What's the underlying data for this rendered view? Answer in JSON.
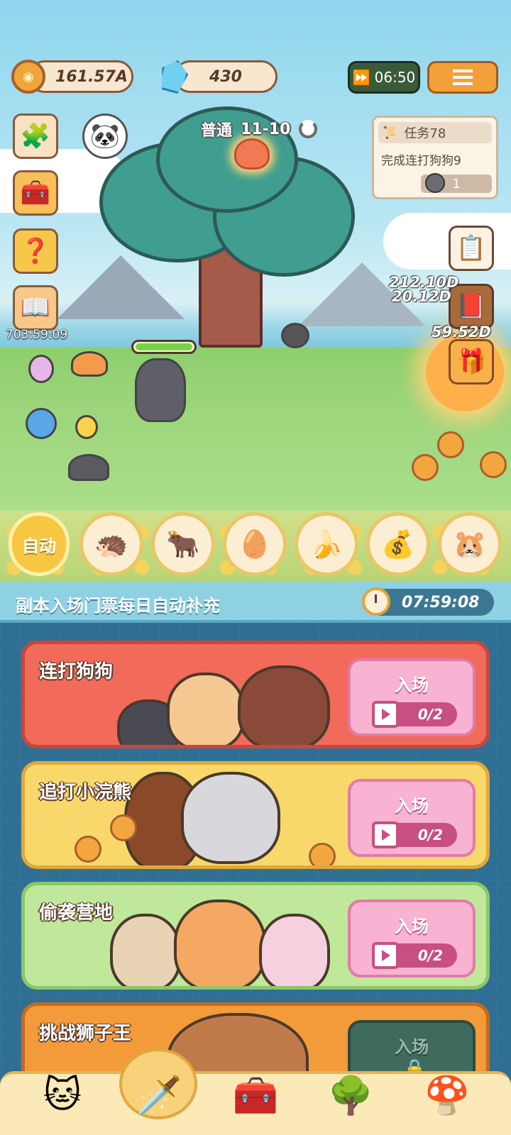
{
  "hud": {
    "coins": "161.57A",
    "gems": "430",
    "speed_timer": "06:50"
  },
  "stage": {
    "mode": "普通",
    "level": "11-10"
  },
  "quest": {
    "title": "任务78",
    "description": "完成连打狗狗9",
    "progress": "1"
  },
  "side": {
    "timer": "703:59:09"
  },
  "floating_numbers": [
    "212.10D",
    "20.12D",
    "59.52D"
  ],
  "skills": {
    "auto_label": "自动"
  },
  "dungeon": {
    "banner": "副本入场门票每日自动补充",
    "refill_timer": "07:59:08",
    "cards": [
      {
        "title": "连打狗狗",
        "button": "入场",
        "tickets": "0/2",
        "color": "#f26a5a"
      },
      {
        "title": "追打小浣熊",
        "button": "入场",
        "tickets": "0/2",
        "color": "#f8d86a"
      },
      {
        "title": "偷袭营地",
        "button": "入场",
        "tickets": "0/2",
        "color": "#bfe89a"
      },
      {
        "title": "挑战狮子王",
        "button": "入场",
        "tickets": "",
        "color": "#f39a3a"
      }
    ]
  },
  "nav": {
    "items": [
      "cat-home-icon",
      "battle-sword-icon",
      "treasure-chest-icon",
      "tree-icon",
      "mushroom-house-icon"
    ],
    "active": 1
  }
}
